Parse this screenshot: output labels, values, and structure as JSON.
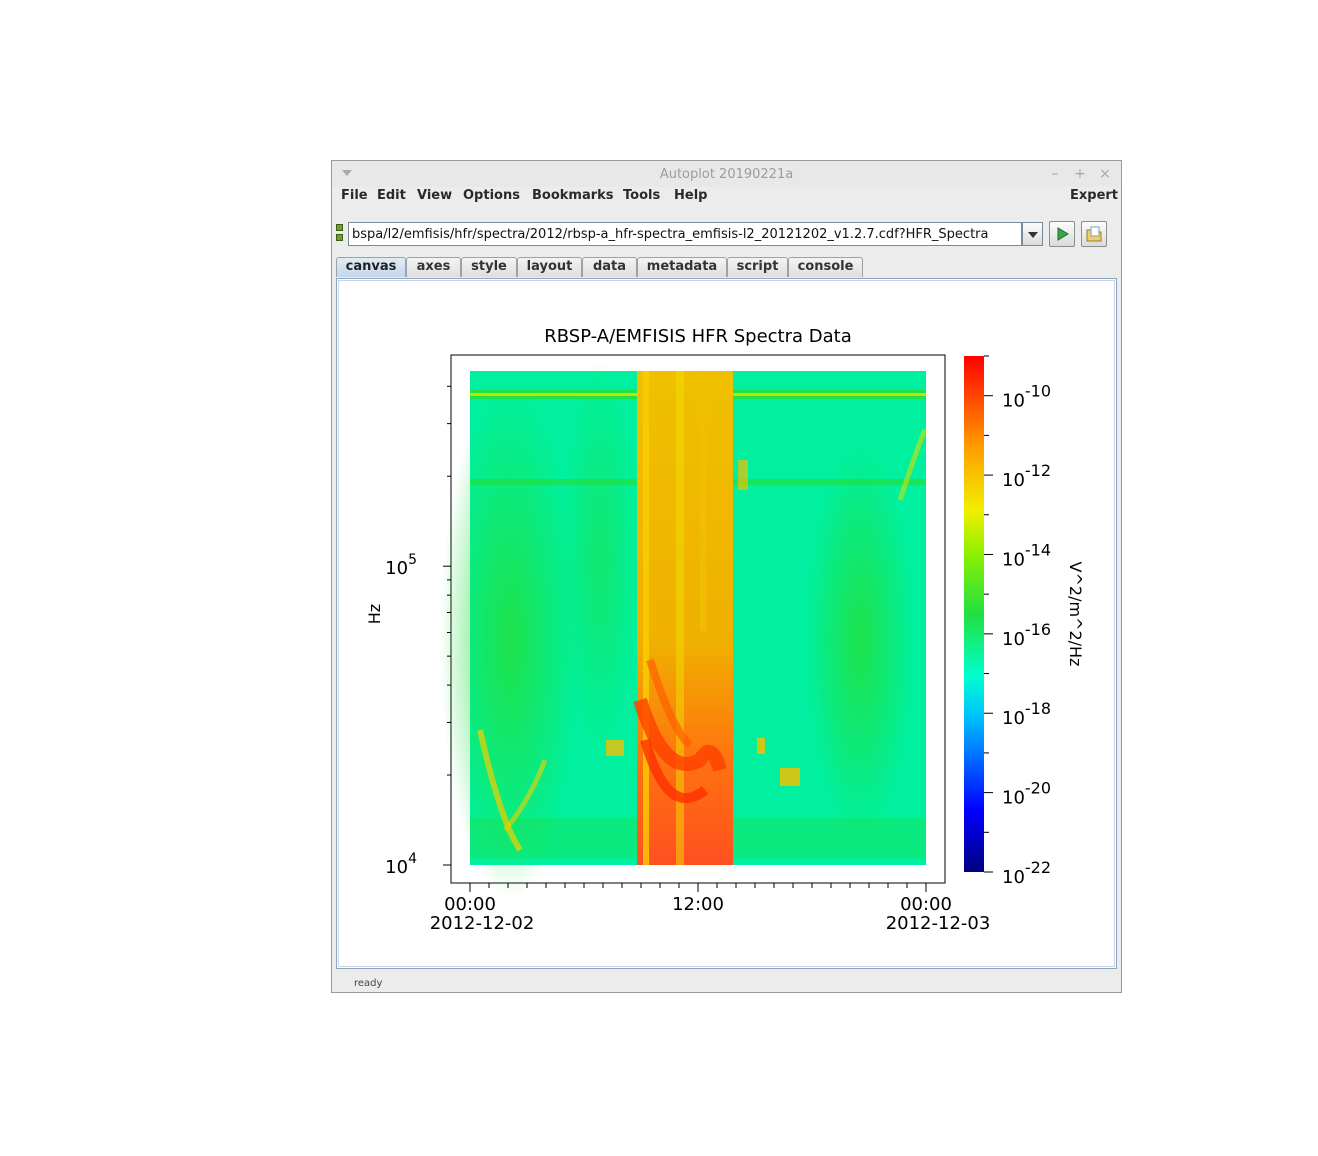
{
  "window": {
    "title": "Autoplot 20190221a"
  },
  "menubar": {
    "items": [
      "File",
      "Edit",
      "View",
      "Options",
      "Bookmarks",
      "Tools",
      "Help"
    ],
    "right": "Expert"
  },
  "url": {
    "value": "bspa/l2/emfisis/hfr/spectra/2012/rbsp-a_hfr-spectra_emfisis-l2_20121202_v1.2.7.cdf?HFR_Spectra"
  },
  "tabs": [
    "canvas",
    "axes",
    "style",
    "layout",
    "data",
    "metadata",
    "script",
    "console"
  ],
  "active_tab": "canvas",
  "status": "ready",
  "colors": {
    "plot_background": "#00f0a0",
    "spectrum_mid": "#20e040",
    "spectrum_high": "#f0c000",
    "spectrum_peak": "#ff3000"
  },
  "chart_data": {
    "type": "heatmap",
    "title": "RBSP-A/EMFISIS  HFR Spectra Data",
    "ylabel": "Hz",
    "yscale": "log",
    "ylim": [
      10000,
      450000
    ],
    "y_ticks": [
      {
        "base": "10",
        "exp": "4"
      },
      {
        "base": "10",
        "exp": "5"
      }
    ],
    "x_ticks": [
      {
        "time": "00:00",
        "date": "2012-12-02"
      },
      {
        "time": "12:00",
        "date": ""
      },
      {
        "time": "00:00",
        "date": "2012-12-03"
      }
    ],
    "xlim": [
      "2012-12-02T00:00",
      "2012-12-03T00:00"
    ],
    "colorbar": {
      "label": "V^2/m^2/Hz",
      "scale": "log",
      "range": [
        1e-22,
        1e-09
      ],
      "ticks": [
        {
          "base": "10",
          "exp": "-10"
        },
        {
          "base": "10",
          "exp": "-12"
        },
        {
          "base": "10",
          "exp": "-14"
        },
        {
          "base": "10",
          "exp": "-16"
        },
        {
          "base": "10",
          "exp": "-18"
        },
        {
          "base": "10",
          "exp": "-20"
        },
        {
          "base": "10",
          "exp": "-22"
        }
      ]
    },
    "features": [
      {
        "name": "broadband emission band",
        "start": "2012-12-02T09:00",
        "end": "2012-12-02T12:30",
        "level": 1e-12
      },
      {
        "name": "narrowband line",
        "frequency_hz": 400000,
        "level": 1e-14
      }
    ]
  }
}
